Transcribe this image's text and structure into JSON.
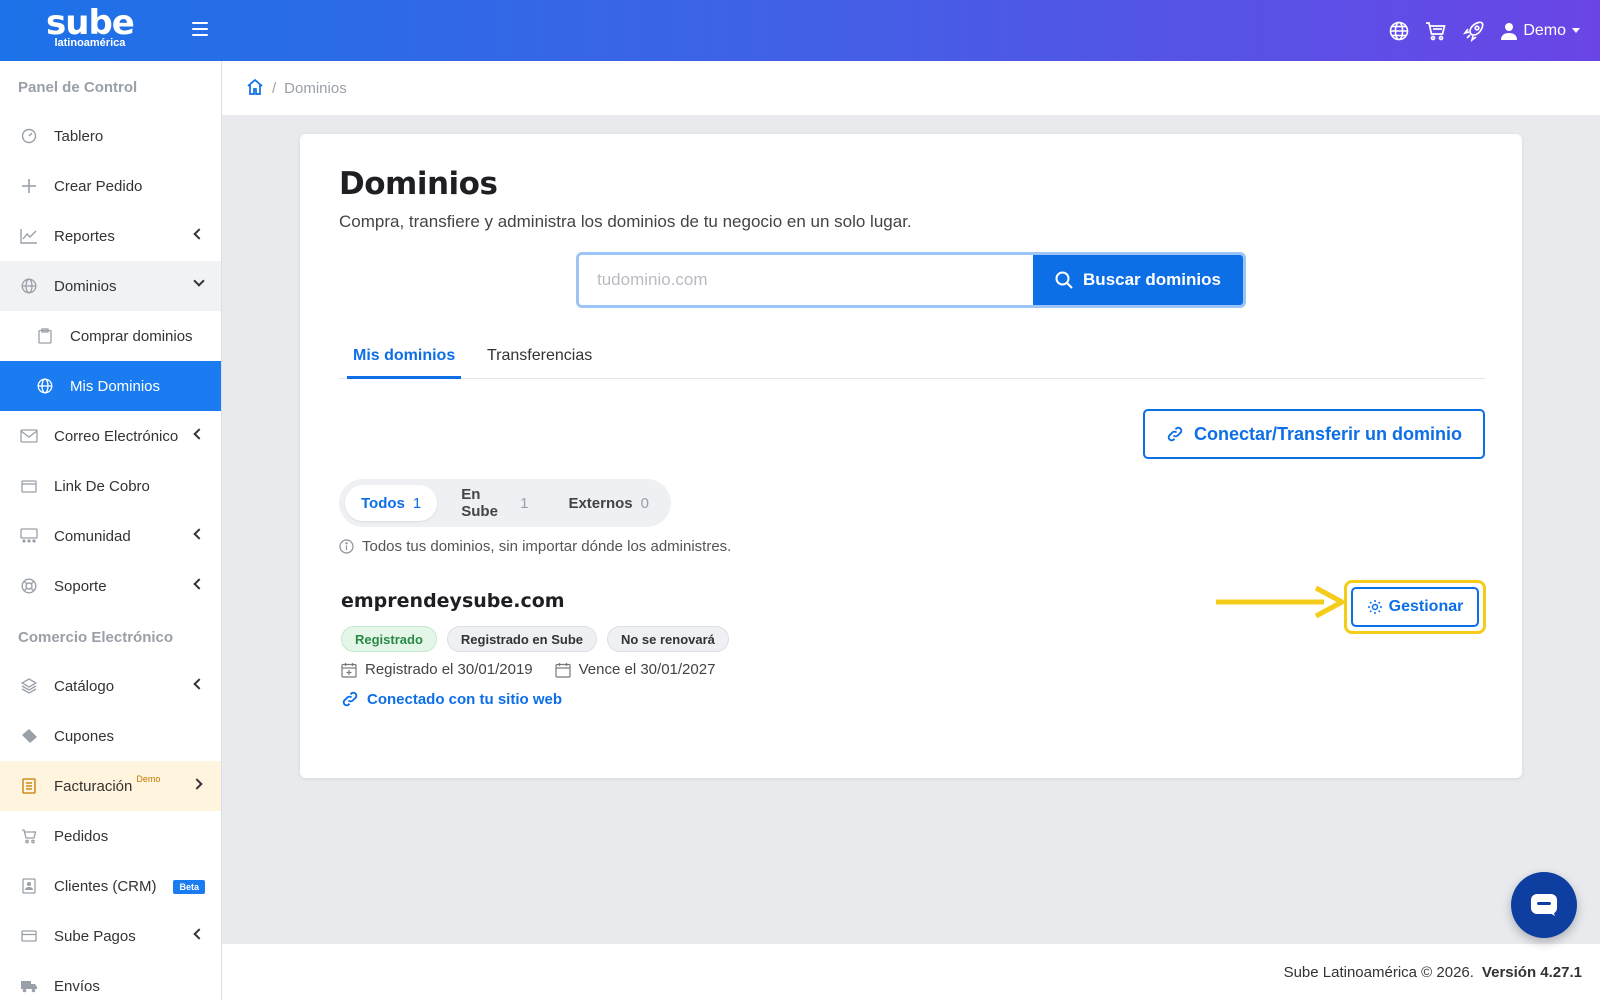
{
  "brand": {
    "name": "sube",
    "subtitle": "latinoamérica"
  },
  "topbar": {
    "user_label": "Demo"
  },
  "sidebar": {
    "section1": "Panel de Control",
    "section2": "Comercio Electrónico",
    "items": {
      "tablero": "Tablero",
      "crear_pedido": "Crear Pedido",
      "reportes": "Reportes",
      "dominios": "Dominios",
      "comprar_dominios": "Comprar dominios",
      "mis_dominios": "Mis Dominios",
      "correo": "Correo Electrónico",
      "link_cobro": "Link De Cobro",
      "comunidad": "Comunidad",
      "soporte": "Soporte",
      "catalogo": "Catálogo",
      "cupones": "Cupones",
      "facturacion": "Facturación",
      "facturacion_sup": "Demo",
      "pedidos": "Pedidos",
      "clientes": "Clientes (CRM)",
      "clientes_badge": "Beta",
      "sube_pagos": "Sube Pagos",
      "envios": "Envíos"
    }
  },
  "breadcrumb": {
    "sep": "/",
    "current": "Dominios"
  },
  "main": {
    "title": "Dominios",
    "subtitle": "Compra, transfiere y administra los dominios de tu negocio en un solo lugar.",
    "search": {
      "placeholder": "tudominio.com",
      "button": "Buscar dominios"
    },
    "tabs": {
      "mis_dominios": "Mis dominios",
      "transferencias": "Transferencias"
    },
    "connect_button": "Conectar/Transferir un dominio",
    "filters": {
      "todos": {
        "label": "Todos",
        "count": "1"
      },
      "en_sube": {
        "label": "En Sube",
        "count": "1"
      },
      "externos": {
        "label": "Externos",
        "count": "0"
      }
    },
    "info": "Todos tus dominios, sin importar dónde los administres.",
    "domain": {
      "name": "emprendeysube.com",
      "badges": {
        "status": "Registrado",
        "registrar": "Registrado en Sube",
        "renewal": "No se renovará"
      },
      "registered": "Registrado el 30/01/2019",
      "expires": "Vence el 30/01/2027",
      "site_link": "Conectado con tu sitio web",
      "manage_button": "Gestionar"
    }
  },
  "footer": {
    "copyright": "Sube Latinoamérica © 2026.",
    "version": "Versión 4.27.1"
  },
  "colors": {
    "primary": "#0d6fe6",
    "highlight": "#f5cc1a",
    "topbar_start": "#1c72e8",
    "topbar_end": "#6a45e6"
  }
}
